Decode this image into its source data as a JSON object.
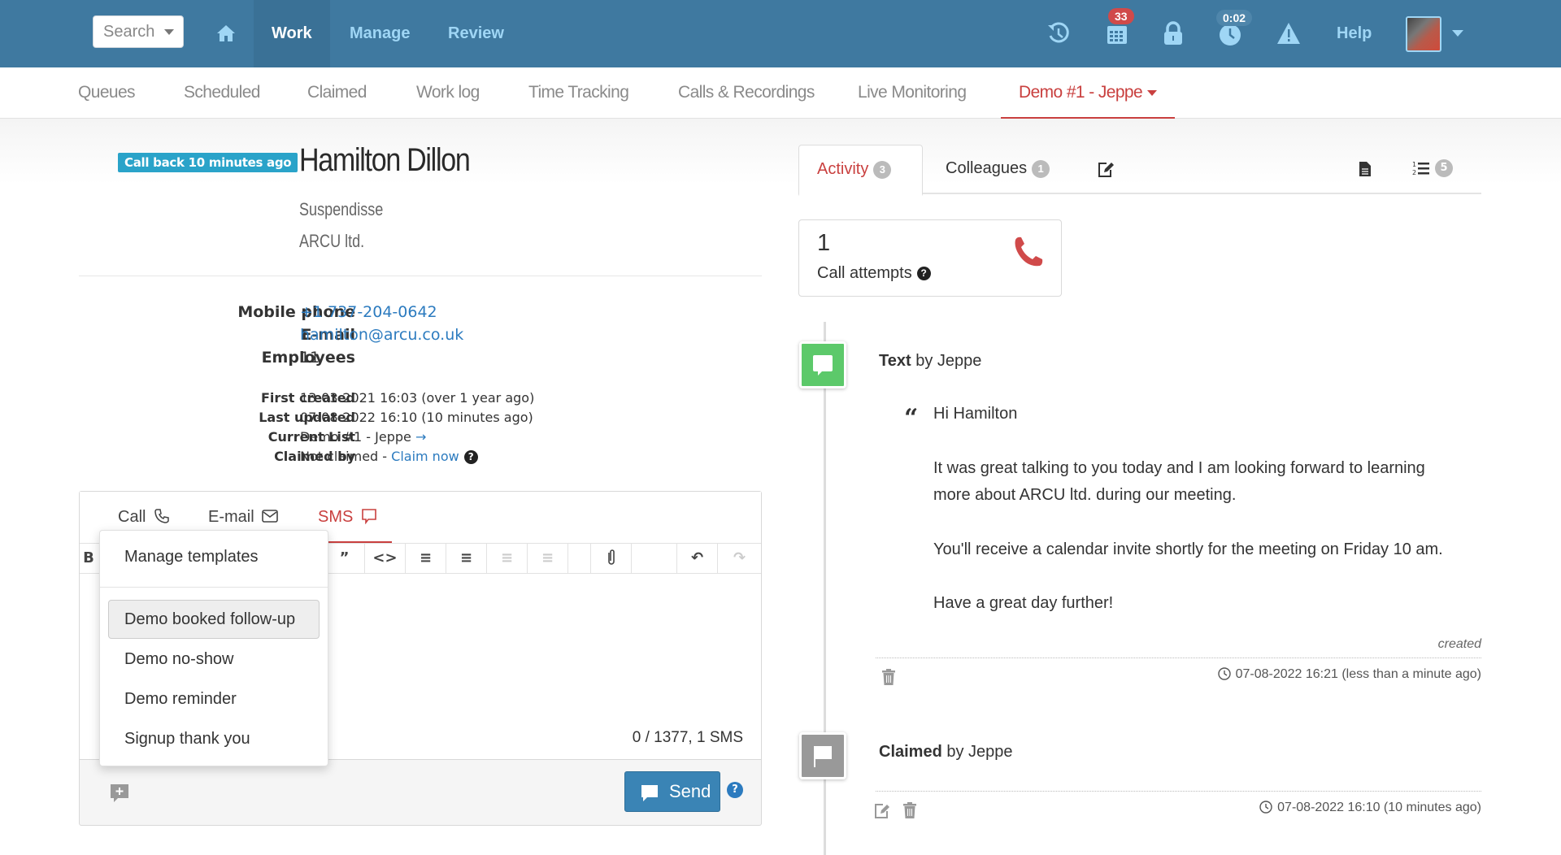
{
  "topbar": {
    "search_label": "Search",
    "nav": [
      {
        "label": "Work",
        "active": true
      },
      {
        "label": "Manage",
        "active": false
      },
      {
        "label": "Review",
        "active": false
      }
    ],
    "calendar_badge": "33",
    "timer_badge": "0:02",
    "help_label": "Help",
    "colors": {
      "bar": "#3f79a0",
      "nav_text": "#9fd6f5",
      "badge_red": "#d04a4a"
    }
  },
  "subnav": {
    "items": [
      "Queues",
      "Scheduled",
      "Claimed",
      "Work log",
      "Time Tracking",
      "Calls & Recordings",
      "Live Monitoring"
    ],
    "active_item": "Demo #1 - Jeppe",
    "accent": "#c9403f"
  },
  "contact": {
    "callback_badge": "Call back 10 minutes ago",
    "name": "Hamilton Dillon",
    "title": "Suspendisse",
    "company": "ARCU ltd.",
    "fields": [
      {
        "label": "Mobile phone",
        "value": "+1 737-204-0642"
      },
      {
        "label": "E-mail",
        "value": "hamilton@arcu.co.uk"
      },
      {
        "label": "Employees",
        "value": "11"
      }
    ],
    "meta": [
      {
        "label": "First created",
        "value": "13-03-2021 16:03 (over 1 year ago)"
      },
      {
        "label": "Last updated",
        "value": "07-08-2022 16:10 (10 minutes ago)"
      },
      {
        "label": "Current List",
        "value": "Demo #1 - Jeppe"
      },
      {
        "label": "Claimed by",
        "value": "Not claimed - ",
        "link": "Claim now"
      }
    ]
  },
  "composer": {
    "tabs": [
      {
        "label": "Call",
        "active": false
      },
      {
        "label": "E-mail",
        "active": false
      },
      {
        "label": "SMS",
        "active": true
      }
    ],
    "char_count": "0 / 1377, 1 SMS",
    "send_label": "Send",
    "help": "?"
  },
  "template_dropdown": {
    "manage_label": "Manage templates",
    "items": [
      {
        "label": "Demo booked follow-up",
        "selected": true
      },
      {
        "label": "Demo no-show",
        "selected": false
      },
      {
        "label": "Demo reminder",
        "selected": false
      },
      {
        "label": "Signup thank you",
        "selected": false
      }
    ]
  },
  "right_panel": {
    "tabs": [
      {
        "label": "Activity",
        "count": "3",
        "active": true
      },
      {
        "label": "Colleagues",
        "count": "1",
        "active": false
      }
    ],
    "list_count": "5",
    "stat": {
      "number": "1",
      "label": "Call attempts"
    },
    "timeline": [
      {
        "type_label": "Text",
        "by": " by Jeppe",
        "icon": "sms-icon",
        "color": "#5cc96a",
        "message": [
          "Hi Hamilton",
          "It was great talking to you today and I am looking forward to learning",
          "more about ARCU ltd. during our meeting.",
          "You'll receive a calendar invite shortly for the meeting on Friday 10 am.",
          "Have a great day further!"
        ],
        "status": "created",
        "timestamp": "07-08-2022 16:21 (less than a minute ago)"
      },
      {
        "type_label": "Claimed",
        "by": " by Jeppe",
        "icon": "flag-icon",
        "color": "#999999",
        "timestamp": "07-08-2022 16:10 (10 minutes ago)"
      }
    ]
  }
}
